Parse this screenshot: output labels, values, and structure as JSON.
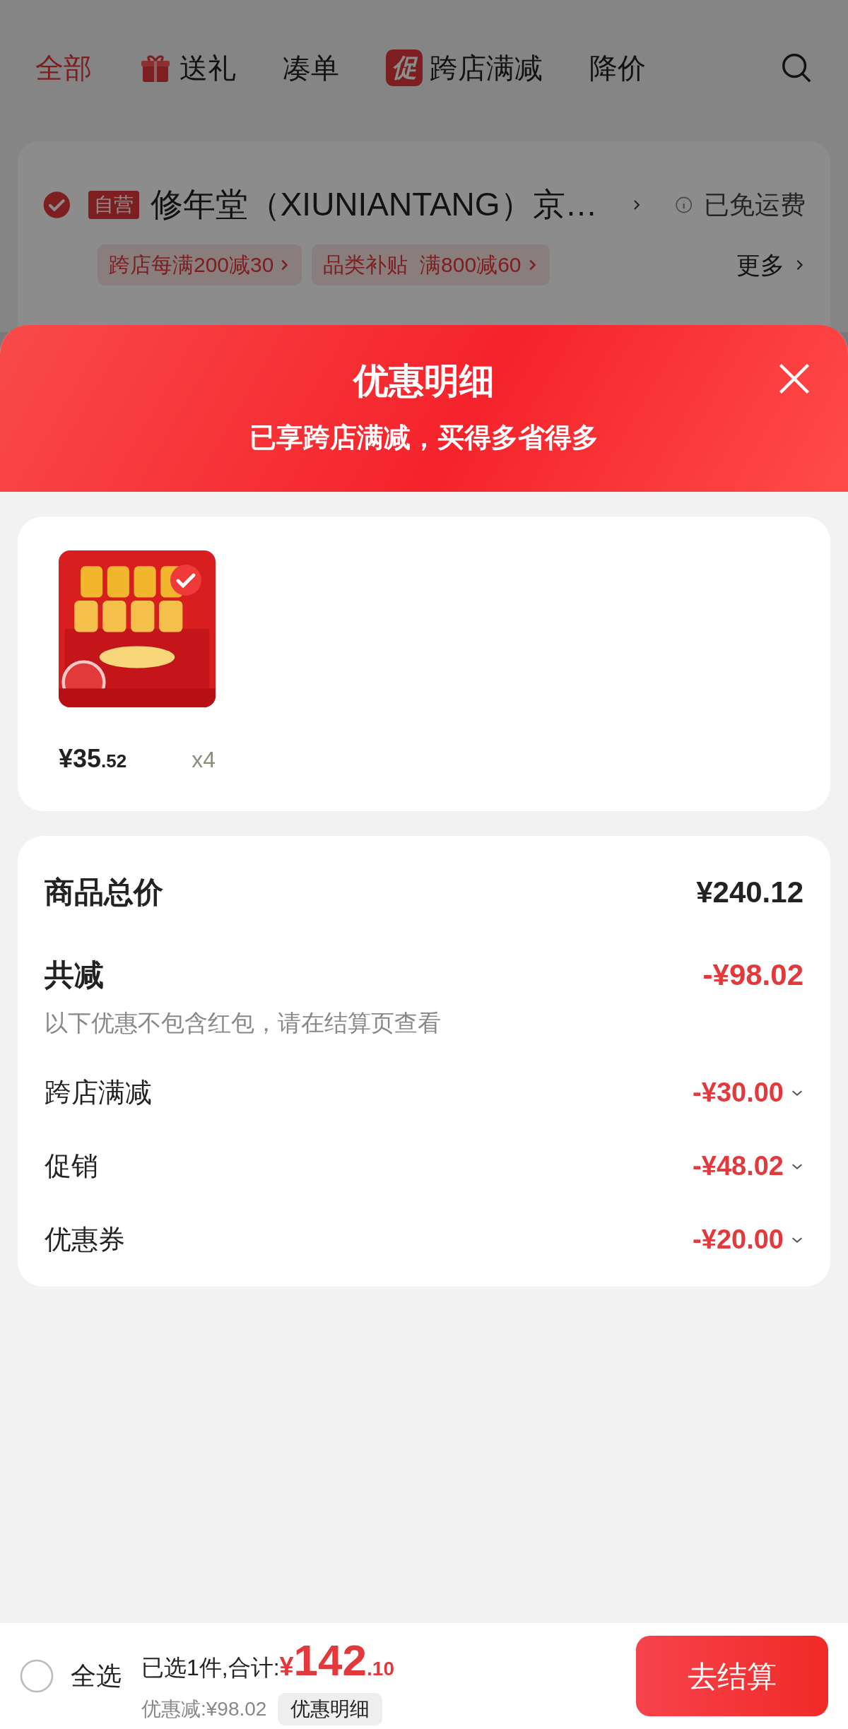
{
  "top_nav": {
    "tabs": [
      {
        "label": "全部",
        "selected": true,
        "kind": "plain"
      },
      {
        "label": "送礼",
        "selected": false,
        "kind": "gift"
      },
      {
        "label": "凑单",
        "selected": false,
        "kind": "plain"
      },
      {
        "label": "跨店满减",
        "selected": false,
        "kind": "badge",
        "badge": "促"
      },
      {
        "label": "降价",
        "selected": false,
        "kind": "plain"
      }
    ]
  },
  "store": {
    "checked": true,
    "tag": "自营",
    "name": "修年堂（XIUNIANTANG）京…",
    "shipping": "已免运费",
    "promos": [
      "跨店每满200减30",
      "品类补贴  满800减60"
    ],
    "more": "更多"
  },
  "sheet": {
    "title": "优惠明细",
    "subtitle": "已享跨店满减，买得多省得多"
  },
  "items": [
    {
      "price": "¥35",
      "price_decimal": ".52",
      "quantity": "x4",
      "selected": true
    }
  ],
  "summary": {
    "total_label": "商品总价",
    "total": "¥240.12",
    "discount_label": "共减",
    "discount": "-¥98.02",
    "note": "以下优惠不包含红包，请在结算页查看",
    "rows": [
      {
        "label": "跨店满减",
        "amount": "-¥30.00"
      },
      {
        "label": "促销",
        "amount": "-¥48.02"
      },
      {
        "label": "优惠券",
        "amount": "-¥20.00"
      }
    ]
  },
  "footer": {
    "select_all": {
      "label": "全选",
      "checked": false
    },
    "summary": "已选1件,合计:",
    "currency": "¥",
    "total": "142",
    "total_decimal": ".10",
    "saved": "优惠减:¥98.02",
    "detail_button": "优惠明细",
    "checkout": "去结算"
  }
}
